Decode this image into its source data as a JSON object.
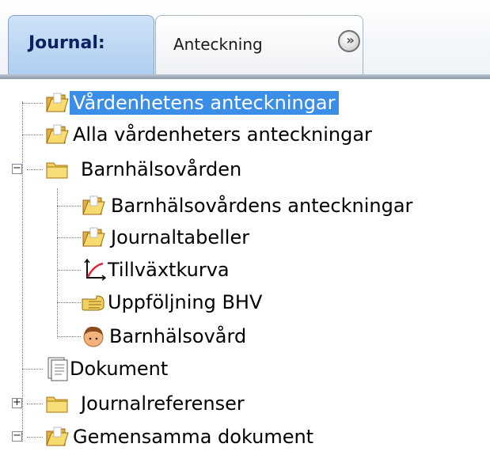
{
  "tabs": {
    "active_label": "Journal:",
    "items": [
      {
        "label": "Anteckning"
      }
    ],
    "more_icon": "double-chevron-right-icon"
  },
  "tree": {
    "nodes": [
      {
        "label": "Vårdenhetens anteckningar",
        "icon": "folder-open-icon",
        "selected": true
      },
      {
        "label": "Alla vårdenheters anteckningar",
        "icon": "folder-open-icon"
      },
      {
        "label": "Barnhälsovården",
        "icon": "folder-closed-icon",
        "expanded": true
      },
      {
        "label": "Barnhälsovårdens anteckningar",
        "icon": "folder-open-icon"
      },
      {
        "label": "Journaltabeller",
        "icon": "folder-open-icon"
      },
      {
        "label": "Tillväxtkurva",
        "icon": "growth-chart-icon"
      },
      {
        "label": "Uppföljning BHV",
        "icon": "pointing-hand-icon"
      },
      {
        "label": "Barnhälsovård",
        "icon": "child-face-icon"
      },
      {
        "label": "Dokument",
        "icon": "document-icon"
      },
      {
        "label": "Journalreferenser",
        "icon": "folder-closed-icon",
        "expanded": false
      },
      {
        "label": "Gemensamma dokument",
        "icon": "folder-open-icon",
        "expanded": true
      }
    ]
  },
  "colors": {
    "selection": "#3a8ee8",
    "active_tab": "#bcd7f3",
    "active_tab_text": "#0a2360"
  }
}
